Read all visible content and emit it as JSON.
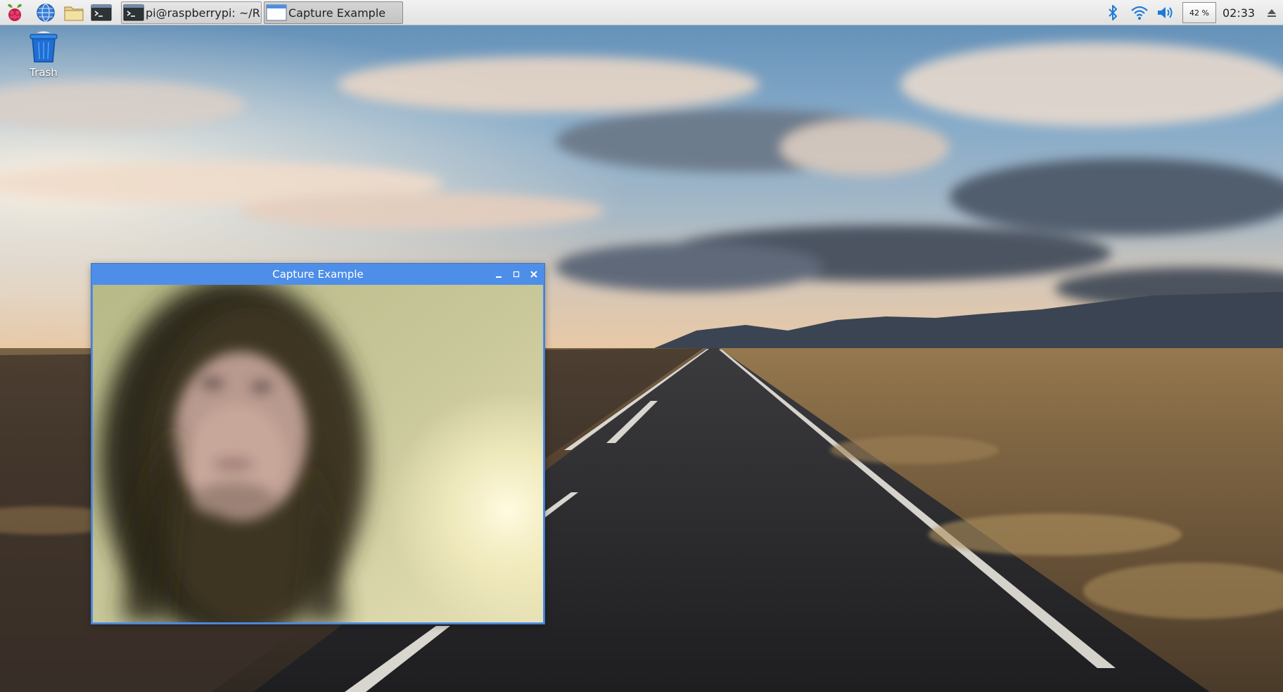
{
  "taskbar": {
    "launchers": [
      {
        "name": "raspberry-menu",
        "icon": "raspberry-pi-logo-icon"
      },
      {
        "name": "web-browser",
        "icon": "globe-icon"
      },
      {
        "name": "file-manager",
        "icon": "folder-icon"
      },
      {
        "name": "terminal",
        "icon": "terminal-icon"
      }
    ],
    "tasks": [
      {
        "label": "pi@raspberrypi: ~/R...",
        "icon": "terminal-icon",
        "active": false
      },
      {
        "label": "Capture Example",
        "icon": "window-icon",
        "active": true
      }
    ],
    "tray": {
      "bluetooth_icon": "bluetooth-icon",
      "wifi_icon": "wifi-icon",
      "volume_icon": "volume-icon",
      "cpu_usage": "42 %",
      "clock": "02:33",
      "eject_icon": "eject-icon"
    }
  },
  "desktop": {
    "icons": [
      {
        "label": "Trash",
        "icon": "trash-icon"
      }
    ],
    "wallpaper": "road-at-sunset"
  },
  "capture_window": {
    "title": "Capture Example",
    "controls": [
      "minimize",
      "maximize",
      "close"
    ],
    "content": "webcam-feed"
  },
  "colors": {
    "taskbar_bg": "#e8e8e8",
    "titlebar": "#4d8ee8",
    "accent_blue": "#1e7bd6"
  }
}
